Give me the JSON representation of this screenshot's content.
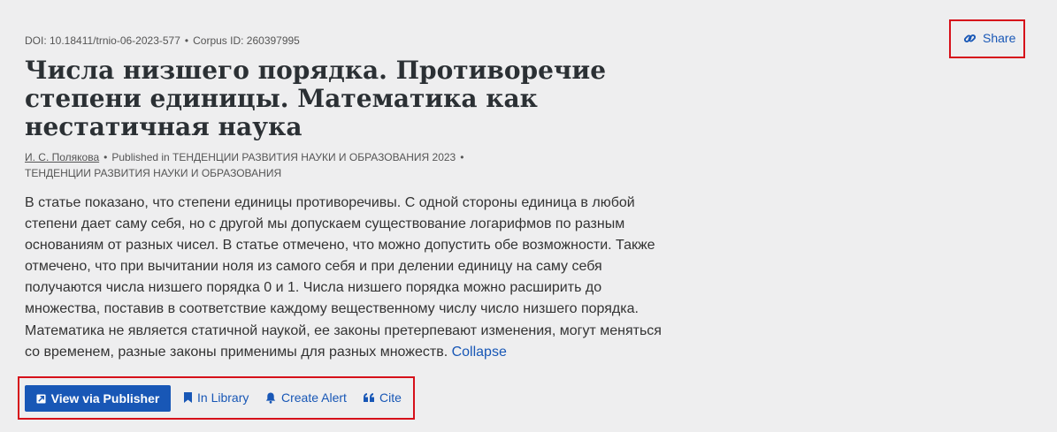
{
  "paper_meta": {
    "doi": "DOI: 10.18411/trnio-06-2023-577",
    "corpus_id": "Corpus ID: 260397995",
    "separator": "•"
  },
  "title": "Числа низшего порядка. Противоречие степени единицы. Математика как нестатичная наука",
  "byline": {
    "author": "И. С. Полякова",
    "published_in": "Published in ТЕНДЕНЦИИ РАЗВИТИЯ НАУКИ И ОБРАЗОВАНИЯ 2023",
    "journal": "ТЕНДЕНЦИИ РАЗВИТИЯ НАУКИ И ОБРАЗОВАНИЯ"
  },
  "abstract": {
    "text": "В статье показано, что степени единицы противоречивы. С одной стороны единица в любой степени дает саму себя, но с другой мы допускаем существование логарифмов по разным основаниям от разных чисел. В статье отмечено, что можно допустить обе возможности. Также отмечено, что при вычитании ноля из самого себя и при делении единицу на саму себя получаются числа низшего порядка 0 и 1. Числа низшего порядка можно расширить до множества, поставив в соответствие каждому вещественному числу число низшего порядка. Математика не является статичной наукой, ее законы претерпевают изменения, могут меняться со временем, разные законы применимы для разных множеств.",
    "collapse_label": "Collapse"
  },
  "share": {
    "label": "Share",
    "icon": "link-icon"
  },
  "actions": {
    "view_via_publisher": "View via Publisher",
    "in_library": "In Library",
    "create_alert": "Create Alert",
    "cite": "Cite"
  },
  "colors": {
    "accent": "#1857b6",
    "highlight_border": "#d6101a",
    "background": "#eeeeef"
  }
}
